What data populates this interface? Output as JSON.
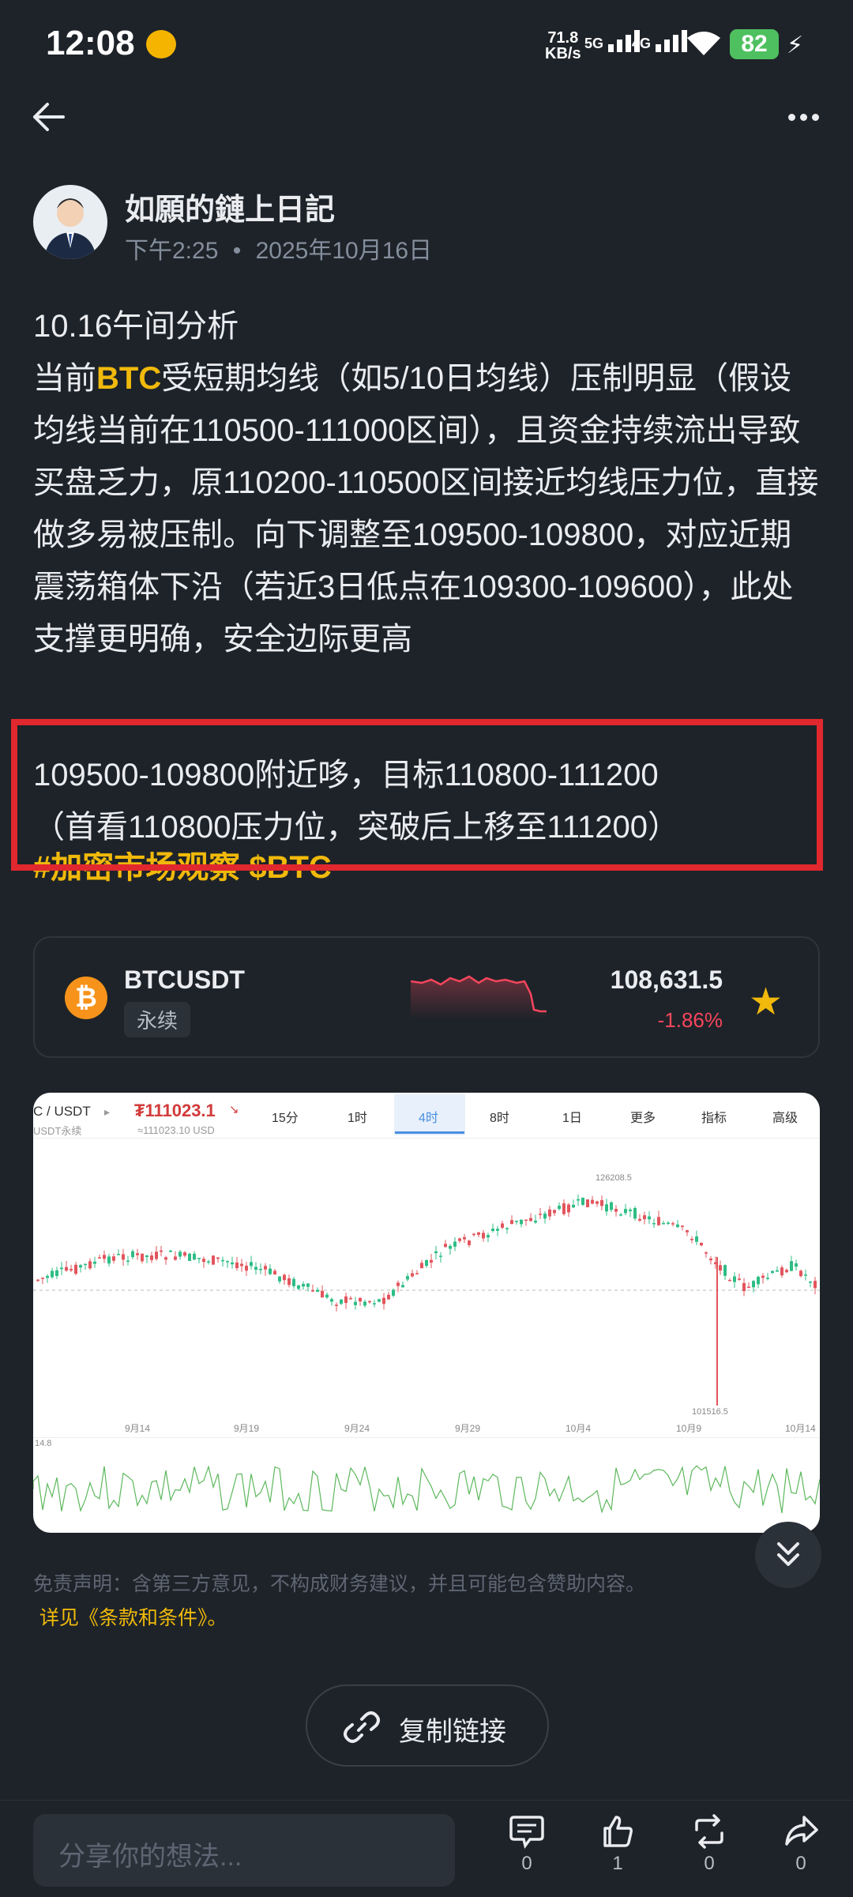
{
  "status_bar": {
    "time": "12:08",
    "net_speed_top": "71.8",
    "net_speed_bottom": "KB/s",
    "sig1": "5G",
    "sig2": "4G",
    "battery": "82"
  },
  "post": {
    "author": "如願的鏈上日記",
    "time": "下午2:25",
    "date": "2025年10月16日",
    "line1": "10.16午间分析",
    "p_pre": "当前",
    "p_btc": "BTC",
    "p_rest": "受短期均线（如5/10日均线）压制明显（假设均线当前在110500-111000区间），且资金持续流出导致买盘乏力，原110200-110500区间接近均线压力位，直接做多易被压制。向下调整至109500-109800，对应近期震荡箱体下沿（若近3日低点在109300-109600），此处支撑更明确，安全边际更高",
    "box_line1": "109500-109800附近哆，目标110800-111200",
    "box_line2": "（首看110800压力位，突破后上移至111200）",
    "tag": "#加密市场观察 $BTC"
  },
  "ticker": {
    "symbol": "BTCUSDT",
    "type": "永续",
    "price": "108,631.5",
    "change": "-1.86%"
  },
  "chart_image": {
    "pair": "C / USDT",
    "sub": "USDT永续",
    "price": "₮111023.1",
    "price_sub": "≈111023.10 USD",
    "tabs": [
      "15分",
      "1时",
      "4时",
      "8时",
      "1日",
      "更多",
      "指标",
      "高级"
    ],
    "active_tab": "4时",
    "high_label": "126208.5",
    "low_label": "101516.5",
    "dates": [
      "9月14",
      "9月19",
      "9月24",
      "9月29",
      "10月4",
      "10月9",
      "10月14"
    ],
    "vol_label": "14.8"
  },
  "disclaimer": "免责声明：含第三方意见，不构成财务建议，并且可能包含赞助内容。",
  "terms": "详见《条款和条件》。",
  "copy_link": "复制链接",
  "bottom": {
    "input_placeholder": "分享你的想法...",
    "comments": "0",
    "likes": "1",
    "reposts": "0",
    "shares": "0"
  },
  "colors": {
    "bg": "#1e2329",
    "accent": "#f0b90b",
    "red": "#f6465d",
    "highlight_box": "#e0282e"
  }
}
